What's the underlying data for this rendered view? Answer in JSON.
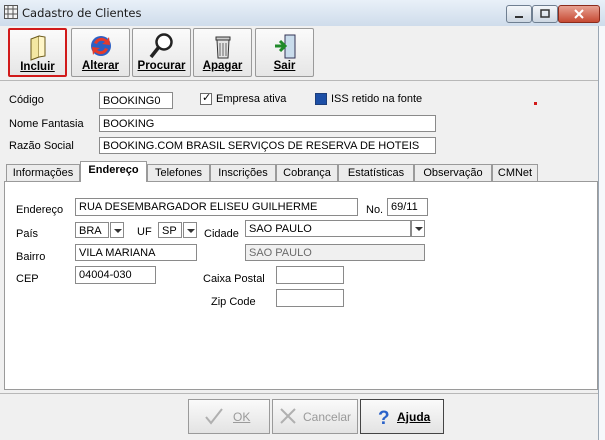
{
  "window": {
    "title": "Cadastro de Clientes"
  },
  "toolbar": {
    "incluir": "Incluir",
    "alterar": "Alterar",
    "procurar": "Procurar",
    "apagar": "Apagar",
    "sair": "Sair"
  },
  "form": {
    "codigo_label": "Código",
    "codigo_value": "BOOKING0",
    "empresa_ativa_label": "Empresa ativa",
    "empresa_ativa_checked": true,
    "iss_label": "ISS retido na fonte",
    "nome_fantasia_label": "Nome Fantasia",
    "nome_fantasia_value": "BOOKING",
    "razao_social_label": "Razão Social",
    "razao_social_value": "BOOKING.COM BRASIL SERVIÇOS DE RESERVA DE HOTEIS"
  },
  "tabs": [
    "Informações",
    "Endereço",
    "Telefones",
    "Inscrições",
    "Cobrança",
    "Estatísticas",
    "Observação",
    "CMNet"
  ],
  "active_tab": "Endereço",
  "endereco": {
    "endereco_label": "Endereço",
    "endereco_value": "RUA DESEMBARGADOR ELISEU GUILHERME",
    "no_label": "No.",
    "no_value": "69/11",
    "pais_label": "País",
    "pais_value": "BRA",
    "uf_label": "UF",
    "uf_value": "SP",
    "cidade_label": "Cidade",
    "cidade_value": "SAO PAULO",
    "cidade_readonly": "SAO PAULO",
    "bairro_label": "Bairro",
    "bairro_value": "VILA MARIANA",
    "cep_label": "CEP",
    "cep_value": "04004-030",
    "caixa_postal_label": "Caixa Postal",
    "caixa_postal_value": "",
    "zip_code_label": "Zip Code",
    "zip_code_value": ""
  },
  "buttons": {
    "ok": "OK",
    "cancelar": "Cancelar",
    "ajuda": "Ajuda"
  },
  "colors": {
    "accent_red": "#d11a1a",
    "iss_checkbox": "#1d4fa6"
  }
}
